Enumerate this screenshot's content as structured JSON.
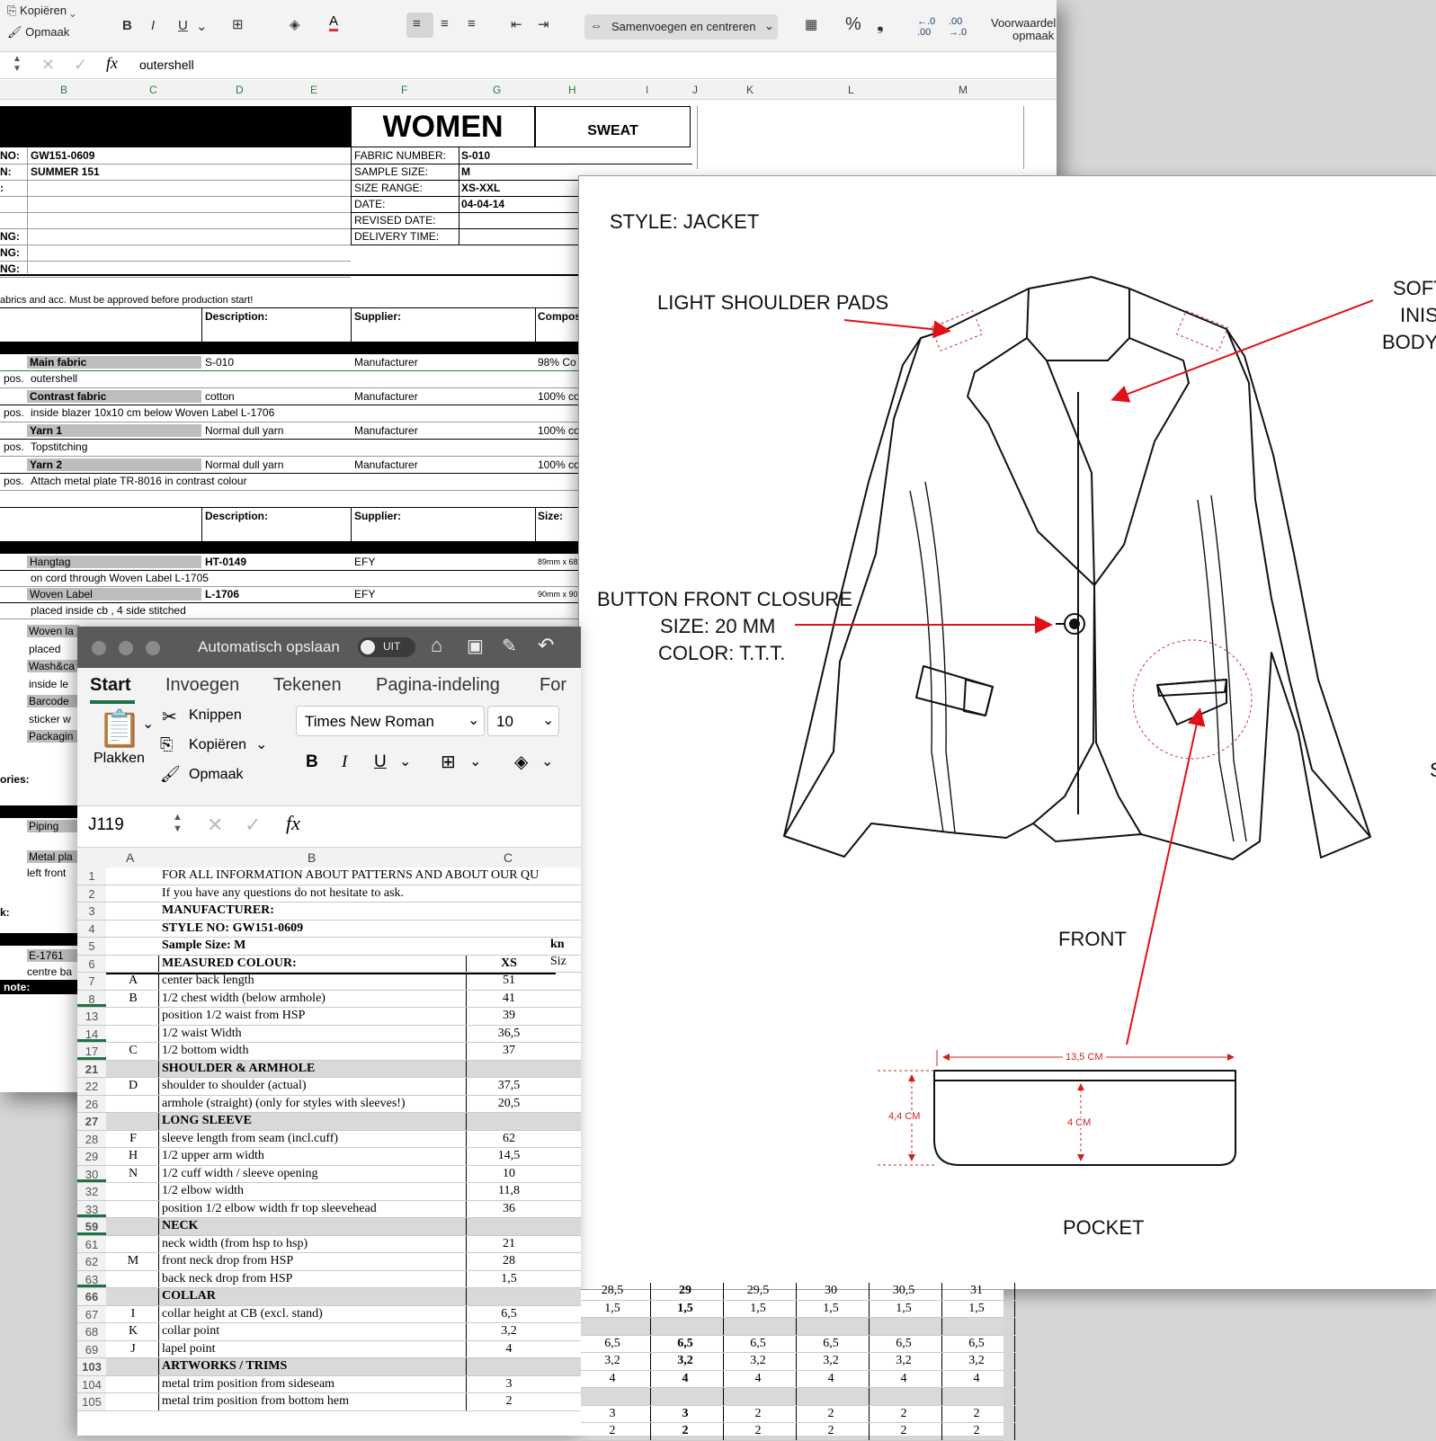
{
  "back_window": {
    "ribbon": {
      "copy": "Kopiëren",
      "format": "Opmaak",
      "merge_center": "Samenvoegen en centreren",
      "conditional": "Voorwaardelijke",
      "conditional2": "opmaak",
      "percent": "%"
    },
    "formula_value": "outershell",
    "fx": "fx",
    "columns": [
      "B",
      "C",
      "D",
      "E",
      "F",
      "G",
      "H",
      "I",
      "J",
      "K",
      "L",
      "M"
    ],
    "header": {
      "women": "WOMEN",
      "sweat": "SWEAT"
    },
    "info_left": [
      {
        "label": "NO:",
        "value": "GW151-0609"
      },
      {
        "label": "N:",
        "value": "SUMMER 151"
      },
      {
        "label": ":",
        "value": ""
      },
      {
        "label": "",
        "value": ""
      },
      {
        "label": "",
        "value": ""
      },
      {
        "label": "NG:",
        "value": ""
      },
      {
        "label": "NG:",
        "value": ""
      },
      {
        "label": "NG:",
        "value": ""
      }
    ],
    "info_right": [
      {
        "label": "FABRIC NUMBER:",
        "value": "S-010"
      },
      {
        "label": "SAMPLE SIZE:",
        "value": "M"
      },
      {
        "label": "SIZE RANGE:",
        "value": "XS-XXL"
      },
      {
        "label": "DATE:",
        "value": "04-04-14"
      },
      {
        "label": "REVISED DATE:",
        "value": ""
      },
      {
        "label": "DELIVERY TIME:",
        "value": ""
      }
    ],
    "note_line": "abrics and acc. Must be approved before production start!",
    "fabric_headers": {
      "description": "Description:",
      "supplier": "Supplier:",
      "composition": "Compos"
    },
    "fabrics": [
      {
        "name": "Main fabric",
        "desc": "S-010",
        "supplier": "Manufacturer",
        "comp": "98% Co",
        "pos": "outershell"
      },
      {
        "name": "Contrast fabric",
        "desc": "cotton",
        "supplier": "Manufacturer",
        "comp": "100% co",
        "pos": "inside blazer 10x10 cm below Woven Label L-1706"
      },
      {
        "name": "Yarn 1",
        "desc": "Normal dull yarn",
        "supplier": "Manufacturer",
        "comp": "100% co",
        "pos": "Topstitching"
      },
      {
        "name": "Yarn 2",
        "desc": "Normal dull yarn",
        "supplier": "Manufacturer",
        "comp": "100% co",
        "pos": "Attach metal plate TR-8016 in contrast colour"
      }
    ],
    "pos_label": "pos.",
    "trim_headers": {
      "description": "Description:",
      "supplier": "Supplier:",
      "size": "Size:"
    },
    "trims": [
      {
        "name": "Hangtag",
        "desc": "HT-0149",
        "supplier": "EFY",
        "size": "89mm x 68",
        "note": "on cord through Woven Label L-1705"
      },
      {
        "name": "Woven Label",
        "desc": "L-1706",
        "supplier": "EFY",
        "size": "90mm x 90",
        "note": "placed inside cb , 4 side stitched"
      }
    ],
    "trims_hidden": [
      "Woven la",
      "placed",
      "Wash&ca",
      "inside le",
      "Barcode",
      "sticker w",
      "Packagin"
    ],
    "lower_labels": {
      "ories": "ories:",
      "piping": "Piping",
      "metal": "Metal pla",
      "left_front": "left front",
      "k": "k:",
      "e1761": "E-1761",
      "centre": "centre ba",
      "note": "note:"
    }
  },
  "sketch": {
    "style": "STYLE: JACKET",
    "shoulder": "LIGHT SHOULDER PADS",
    "soft_1": "SOFT",
    "soft_2": "INIS",
    "soft_3": "BODY",
    "button_1": "BUTTON FRONT CLOSURE",
    "button_2": "SIZE: 20 MM",
    "button_3": "COLOR: T.T.T.",
    "front": "FRONT",
    "pocket": "POCKET",
    "dim_width": "13,5 CM",
    "dim_height": "4,4 CM",
    "dim_inner": "4 CM",
    "edge_s": "S"
  },
  "front_window": {
    "autosave": "Automatisch opslaan",
    "toggle": "UIT",
    "tabs": [
      "Start",
      "Invoegen",
      "Tekenen",
      "Pagina-indeling",
      "For"
    ],
    "paste": "Plakken",
    "cut": "Knippen",
    "copy": "Kopiëren",
    "format": "Opmaak",
    "font": "Times New Roman",
    "font_size": "10",
    "cell_ref": "J119",
    "fx": "fx",
    "columns": [
      "A",
      "B",
      "C"
    ],
    "rows": [
      {
        "n": "1",
        "a": "",
        "b": "FOR ALL INFORMATION ABOUT PATTERNS AND ABOUT OUR QUALITY S",
        "c": "",
        "type": "text"
      },
      {
        "n": "2",
        "a": "",
        "b": " If you have any questions do not hesitate to ask.",
        "c": "",
        "type": "text"
      },
      {
        "n": "3",
        "a": "",
        "b": "MANUFACTURER:",
        "c": "",
        "type": "title"
      },
      {
        "n": "4",
        "a": "",
        "b": "STYLE NO: GW151-0609",
        "c": "",
        "type": "title"
      },
      {
        "n": "5",
        "a": "",
        "b": "Sample Size: M",
        "c": "",
        "type": "title"
      },
      {
        "n": "6",
        "a": "",
        "b": "MEASURED COLOUR:",
        "c": "XS",
        "type": "title"
      },
      {
        "n": "7",
        "a": "A",
        "b": "center back length",
        "c": "51",
        "type": "m"
      },
      {
        "n": "8",
        "a": "B",
        "b": "1/2 chest width (below armhole)",
        "c": "41",
        "type": "m"
      },
      {
        "n": "13",
        "a": "",
        "b": "position 1/2 waist from HSP",
        "c": "39",
        "type": "m"
      },
      {
        "n": "14",
        "a": "",
        "b": "1/2 waist Width",
        "c": "36,5",
        "type": "m"
      },
      {
        "n": "17",
        "a": "C",
        "b": "1/2 bottom width",
        "c": "37",
        "type": "m"
      },
      {
        "n": "21",
        "a": "",
        "b": "SHOULDER & ARMHOLE",
        "c": "",
        "type": "section"
      },
      {
        "n": "22",
        "a": "D",
        "b": "shoulder to shoulder (actual)",
        "c": "37,5",
        "type": "m"
      },
      {
        "n": "26",
        "a": "",
        "b": "armhole (straight) (only for styles with sleeves!)",
        "c": "20,5",
        "type": "m"
      },
      {
        "n": "27",
        "a": "",
        "b": "LONG SLEEVE",
        "c": "",
        "type": "section"
      },
      {
        "n": "28",
        "a": "F",
        "b": "sleeve length from seam (incl.cuff)",
        "c": "62",
        "type": "m"
      },
      {
        "n": "29",
        "a": "H",
        "b": "1/2 upper arm width",
        "c": "14,5",
        "type": "m"
      },
      {
        "n": "30",
        "a": "N",
        "b": "1/2 cuff width / sleeve opening",
        "c": "10",
        "type": "m"
      },
      {
        "n": "32",
        "a": "",
        "b": "1/2 elbow width",
        "c": "11,8",
        "type": "m"
      },
      {
        "n": "33",
        "a": "",
        "b": "position 1/2 elbow width fr top sleevehead",
        "c": "36",
        "type": "m"
      },
      {
        "n": "59",
        "a": "",
        "b": "NECK",
        "c": "",
        "type": "section"
      },
      {
        "n": "61",
        "a": "",
        "b": "neck width (from hsp to hsp)",
        "c": "21",
        "type": "m"
      },
      {
        "n": "62",
        "a": "M",
        "b": "front neck drop from HSP",
        "c": "28",
        "type": "m"
      },
      {
        "n": "63",
        "a": "",
        "b": "back neck drop from HSP",
        "c": "1,5",
        "type": "m"
      },
      {
        "n": "66",
        "a": "",
        "b": "COLLAR",
        "c": "",
        "type": "section"
      },
      {
        "n": "67",
        "a": "I",
        "b": "collar height at CB (excl. stand)",
        "c": "6,5",
        "type": "m"
      },
      {
        "n": "68",
        "a": "K",
        "b": "collar point",
        "c": "3,2",
        "type": "m"
      },
      {
        "n": "69",
        "a": "J",
        "b": "lapel point",
        "c": "4",
        "type": "m"
      },
      {
        "n": "103",
        "a": "",
        "b": "ARTWORKS / TRIMS",
        "c": "",
        "type": "section"
      },
      {
        "n": "104",
        "a": "",
        "b": "metal trim position from sideseam",
        "c": "3",
        "type": "m"
      },
      {
        "n": "105",
        "a": "",
        "b": "metal trim position from bottom hem",
        "c": "2",
        "type": "m"
      }
    ],
    "side_partial": {
      "kn": "kn",
      "siz": "Siz"
    },
    "extended_rows": [
      {
        "n": "62",
        "vals": [
          "28,5",
          "29",
          "29,5",
          "30",
          "30,5",
          "31"
        ]
      },
      {
        "n": "63",
        "vals": [
          "1,5",
          "1,5",
          "1,5",
          "1,5",
          "1,5",
          "1,5"
        ]
      },
      {
        "n": "66",
        "vals": [
          "",
          "",
          "",
          "",
          "",
          ""
        ]
      },
      {
        "n": "67",
        "vals": [
          "6,5",
          "6,5",
          "6,5",
          "6,5",
          "6,5",
          "6,5"
        ]
      },
      {
        "n": "68",
        "vals": [
          "3,2",
          "3,2",
          "3,2",
          "3,2",
          "3,2",
          "3,2"
        ]
      },
      {
        "n": "69",
        "vals": [
          "4",
          "4",
          "4",
          "4",
          "4",
          "4"
        ]
      },
      {
        "n": "103",
        "vals": [
          "",
          "",
          "",
          "",
          "",
          ""
        ]
      },
      {
        "n": "104",
        "vals": [
          "3",
          "3",
          "2",
          "2",
          "2",
          "2"
        ]
      },
      {
        "n": "105",
        "vals": [
          "2",
          "2",
          "2",
          "2",
          "2",
          "2"
        ]
      }
    ]
  }
}
